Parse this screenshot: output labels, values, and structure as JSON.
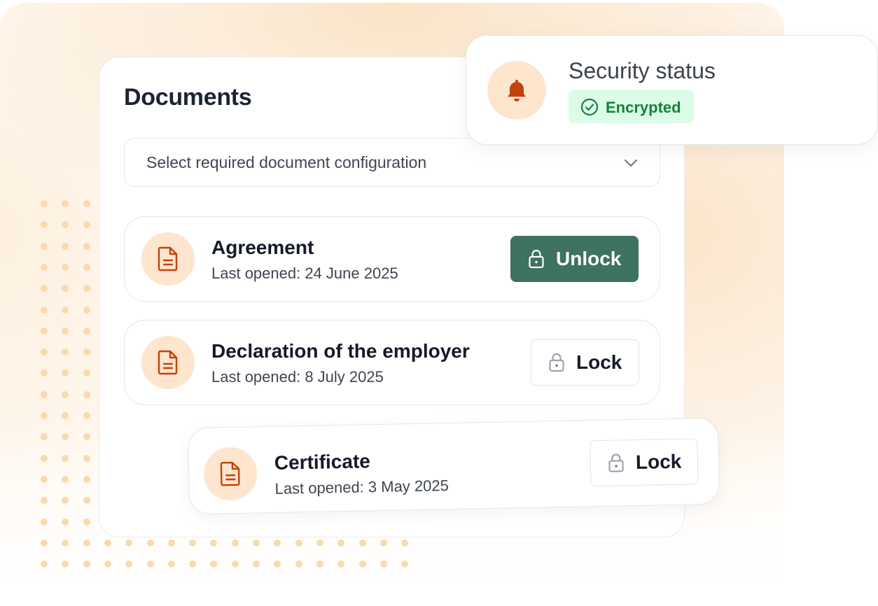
{
  "documents": {
    "title": "Documents",
    "select_placeholder": "Select required document configuration",
    "items": [
      {
        "name": "Agreement",
        "last_opened": "Last opened: 24 June 2025",
        "action": "Unlock"
      },
      {
        "name": "Declaration of the employer",
        "last_opened": "Last opened: 8 July 2025",
        "action": "Lock"
      },
      {
        "name": "Certificate",
        "last_opened": "Last opened: 3 May 2025",
        "action": "Lock"
      }
    ]
  },
  "security": {
    "title": "Security status",
    "status": "Encrypted"
  },
  "icons": {
    "document": "file-text-icon",
    "bell": "bell-icon",
    "lock": "lock-icon",
    "chevron": "chevron-down-icon",
    "check": "check-circle-icon"
  },
  "colors": {
    "accent": "#c2410c",
    "unlock_button": "#3e7261",
    "badge_bg": "#dcfce7",
    "badge_text": "#15803d",
    "icon_circle": "#fde6cd"
  }
}
